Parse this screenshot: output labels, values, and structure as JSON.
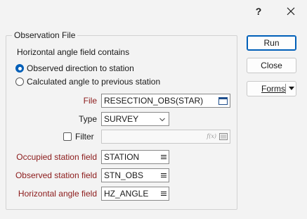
{
  "titlebar": {
    "help_glyph": "?",
    "close_glyph": "✕"
  },
  "group": {
    "title": "Observation File",
    "heading": "Horizontal angle field contains",
    "radios": [
      {
        "label": "Observed direction to station",
        "checked": true
      },
      {
        "label": "Calculated angle to previous station",
        "checked": false
      }
    ]
  },
  "file": {
    "label": "File",
    "value": "RESECTION_OBS(STAR)"
  },
  "type": {
    "label": "Type",
    "value": "SURVEY"
  },
  "filter": {
    "label": "Filter",
    "checked": false,
    "value": "",
    "fx_text": "f(x)"
  },
  "occupied": {
    "label": "Occupied station field",
    "value": "STATION"
  },
  "observed": {
    "label": "Observed station field",
    "value": "STN_OBS"
  },
  "hz_angle": {
    "label": "Horizontal angle field",
    "value": "HZ_ANGLE"
  },
  "buttons": {
    "run": "Run",
    "close": "Close",
    "forms": "Forms"
  },
  "colors": {
    "accent": "#005fb8",
    "required_label": "#8b1a1a"
  }
}
